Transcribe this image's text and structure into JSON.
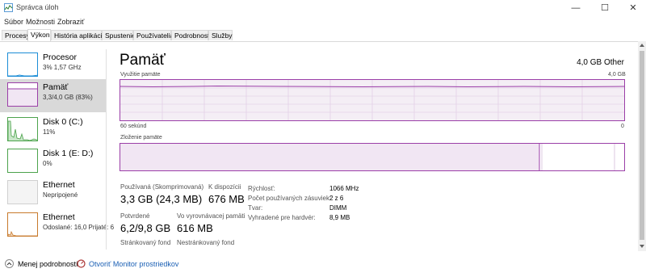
{
  "window": {
    "title": "Správca úloh",
    "minimize": "—",
    "maximize": "☐",
    "close": "✕"
  },
  "menu": [
    "Súbor",
    "Možnosti",
    "Zobraziť"
  ],
  "tabs": [
    "Procesy",
    "Výkon",
    "História aplikácií",
    "Spustenie",
    "Používatelia",
    "Podrobnosti",
    "Služby"
  ],
  "sidebar": [
    {
      "title": "Procesor",
      "sub": "3% 1,57 GHz",
      "color": "#1c8dd6"
    },
    {
      "title": "Pamäť",
      "sub": "3,3/4,0 GB (83%)",
      "color": "#9b3fa8"
    },
    {
      "title": "Disk 0 (C:)",
      "sub": "11%",
      "color": "#4da34d"
    },
    {
      "title": "Disk 1 (E: D:)",
      "sub": "0%",
      "color": "#4da34d"
    },
    {
      "title": "Ethernet",
      "sub": "Nepripojené",
      "color": "#c0c0c0"
    },
    {
      "title": "Ethernet",
      "sub": "Odoslané: 16,0 Prijaté: 6",
      "color": "#c87a2c"
    }
  ],
  "main": {
    "title": "Pamäť",
    "total": "4,0 GB Other",
    "usage_label": "Využitie pamäte",
    "usage_max": "4,0 GB",
    "time_label": "60 sekúnd",
    "time_min": "0",
    "composition_label": "Zloženie pamäte",
    "usage_level": 0.83
  },
  "stats": {
    "in_use_label": "Používaná (Skomprimovaná)",
    "in_use_value": "3,3 GB (24,3 MB)",
    "available_label": "K dispozícii",
    "available_value": "676 MB",
    "committed_label": "Potvrdené",
    "committed_value": "6,2/9,8 GB",
    "cached_label": "Vo vyrovnávacej pamäti",
    "cached_value": "616 MB",
    "paged_label": "Stránkovaný fond",
    "nonpaged_label": "Nestránkovaný fond"
  },
  "specs": {
    "speed_label": "Rýchlosť:",
    "speed_value": "1066 MHz",
    "slots_label": "Počet používaných zásuviek:",
    "slots_value": "2 z 6",
    "form_label": "Tvar:",
    "form_value": "DIMM",
    "reserved_label": "Vyhradené pre hardvér:",
    "reserved_value": "8,9 MB"
  },
  "footer": {
    "less_details": "Menej podrobností",
    "open_monitor": "Otvoriť Monitor prostriedkov"
  }
}
